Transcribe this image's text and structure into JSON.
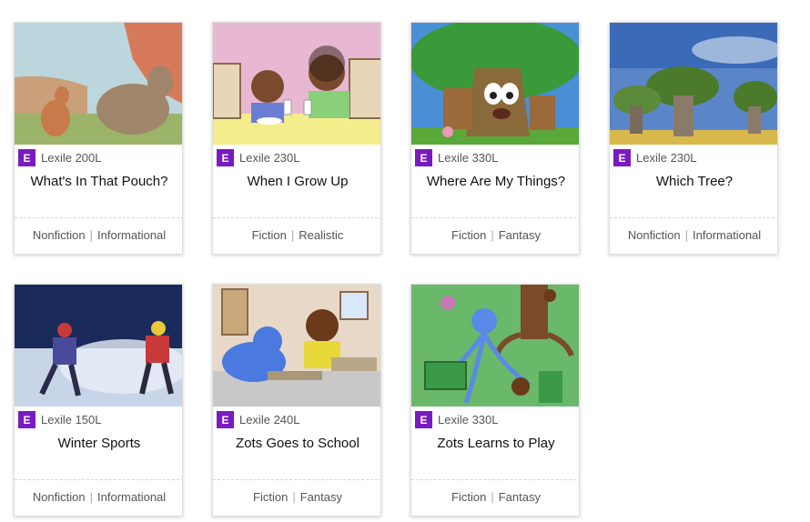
{
  "colors": {
    "badge": "#7a1bc2",
    "text": "#111111",
    "meta_text": "#555555"
  },
  "books": [
    {
      "level": "E",
      "lexile": "Lexile 200L",
      "title": "What's In That Pouch?",
      "genre": "Nonfiction",
      "type": "Informational",
      "cover": "kangaroo-illustration"
    },
    {
      "level": "E",
      "lexile": "Lexile 230L",
      "title": "When I Grow Up",
      "genre": "Fiction",
      "type": "Realistic",
      "cover": "children-at-table-illustration"
    },
    {
      "level": "E",
      "lexile": "Lexile 330L",
      "title": "Where Are My Things?",
      "genre": "Fiction",
      "type": "Fantasy",
      "cover": "tree-character-illustration"
    },
    {
      "level": "E",
      "lexile": "Lexile 230L",
      "title": "Which Tree?",
      "genre": "Nonfiction",
      "type": "Informational",
      "cover": "baobab-trees-photo"
    },
    {
      "level": "E",
      "lexile": "Lexile 150L",
      "title": "Winter Sports",
      "genre": "Nonfiction",
      "type": "Informational",
      "cover": "snowshoe-runners-photo"
    },
    {
      "level": "E",
      "lexile": "Lexile 240L",
      "title": "Zots Goes to School",
      "genre": "Fiction",
      "type": "Fantasy",
      "cover": "classroom-alien-illustration"
    },
    {
      "level": "E",
      "lexile": "Lexile 330L",
      "title": "Zots Learns to Play",
      "genre": "Fiction",
      "type": "Fantasy",
      "cover": "playground-alien-illustration"
    }
  ]
}
